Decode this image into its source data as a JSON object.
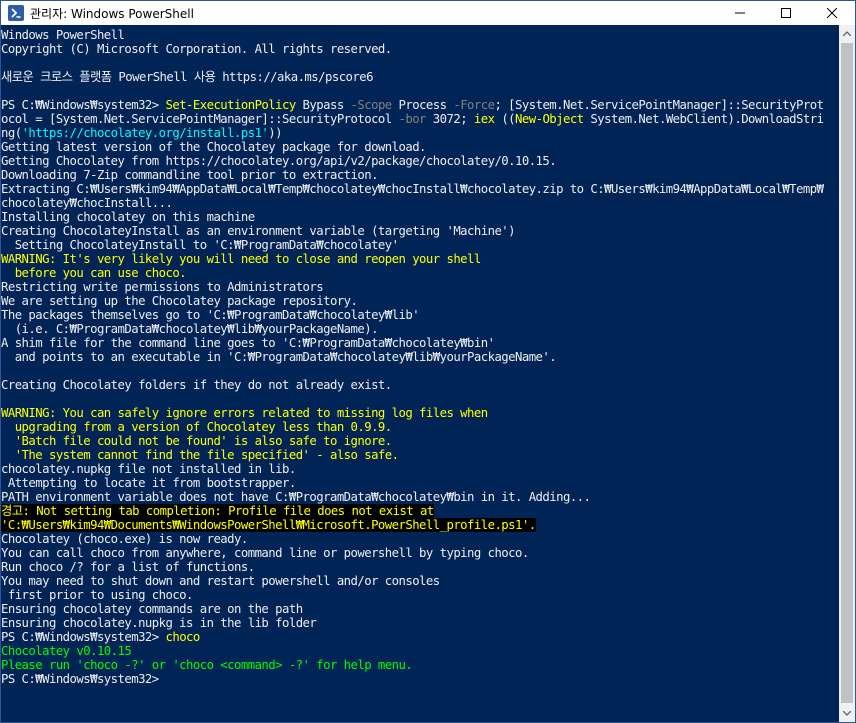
{
  "window": {
    "title": "관리자: Windows PowerShell"
  },
  "colors": {
    "background": "#012456",
    "text": "#eeedf0",
    "command": "#ffff00",
    "parameter": "#808080",
    "string": "#00ffff",
    "warning": "#ffff00",
    "error_bg": "#000000",
    "green": "#00ff00"
  },
  "console": {
    "lines": [
      [
        {
          "t": "Windows PowerShell"
        }
      ],
      [
        {
          "t": "Copyright (C) Microsoft Corporation. All rights reserved."
        }
      ],
      [],
      [
        {
          "t": "새로운 크로스 플랫폼 PowerShell 사용 https://aka.ms/pscore6"
        }
      ],
      [],
      [
        {
          "t": "PS C:₩Windows₩system32> "
        },
        {
          "t": "Set-ExecutionPolicy",
          "c": "command"
        },
        {
          "t": " Bypass "
        },
        {
          "t": "-Scope",
          "c": "parameter"
        },
        {
          "t": " Process "
        },
        {
          "t": "-Force",
          "c": "parameter"
        },
        {
          "t": "; [System.Net.ServicePointManager]::SecurityProt"
        }
      ],
      [
        {
          "t": "ocol = [System.Net.ServicePointManager]::SecurityProtocol "
        },
        {
          "t": "-bor",
          "c": "parameter"
        },
        {
          "t": " 3072; "
        },
        {
          "t": "iex",
          "c": "command"
        },
        {
          "t": " (("
        },
        {
          "t": "New-Object",
          "c": "command"
        },
        {
          "t": " System.Net.WebClient).DownloadStri"
        }
      ],
      [
        {
          "t": "ng("
        },
        {
          "t": "'https://chocolatey.org/install.ps1'",
          "c": "string"
        },
        {
          "t": "))"
        }
      ],
      [
        {
          "t": "Getting latest version of the Chocolatey package for download."
        }
      ],
      [
        {
          "t": "Getting Chocolatey from https://chocolatey.org/api/v2/package/chocolatey/0.10.15."
        }
      ],
      [
        {
          "t": "Downloading 7-Zip commandline tool prior to extraction."
        }
      ],
      [
        {
          "t": "Extracting C:₩Users₩kim94₩AppData₩Local₩Temp₩chocolatey₩chocInstall₩chocolatey.zip to C:₩Users₩kim94₩AppData₩Local₩Temp₩"
        }
      ],
      [
        {
          "t": "chocolatey₩chocInstall..."
        }
      ],
      [
        {
          "t": "Installing chocolatey on this machine"
        }
      ],
      [
        {
          "t": "Creating ChocolateyInstall as an environment variable (targeting 'Machine')"
        }
      ],
      [
        {
          "t": "  Setting ChocolateyInstall to 'C:₩ProgramData₩chocolatey'"
        }
      ],
      [
        {
          "t": "WARNING: It's very likely you will need to close and reopen your shell",
          "c": "warning"
        }
      ],
      [
        {
          "t": "  before you can use choco.",
          "c": "warning"
        }
      ],
      [
        {
          "t": "Restricting write permissions to Administrators"
        }
      ],
      [
        {
          "t": "We are setting up the Chocolatey package repository."
        }
      ],
      [
        {
          "t": "The packages themselves go to 'C:₩ProgramData₩chocolatey₩lib'"
        }
      ],
      [
        {
          "t": "  (i.e. C:₩ProgramData₩chocolatey₩lib₩yourPackageName)."
        }
      ],
      [
        {
          "t": "A shim file for the command line goes to 'C:₩ProgramData₩chocolatey₩bin'"
        }
      ],
      [
        {
          "t": "  and points to an executable in 'C:₩ProgramData₩chocolatey₩lib₩yourPackageName'."
        }
      ],
      [],
      [
        {
          "t": "Creating Chocolatey folders if they do not already exist."
        }
      ],
      [],
      [
        {
          "t": "WARNING: You can safely ignore errors related to missing log files when",
          "c": "warning"
        }
      ],
      [
        {
          "t": "  upgrading from a version of Chocolatey less than 0.9.9.",
          "c": "warning"
        }
      ],
      [
        {
          "t": "  'Batch file could not be found' is also safe to ignore.",
          "c": "warning"
        }
      ],
      [
        {
          "t": "  'The system cannot find the file specified' - also safe.",
          "c": "warning"
        }
      ],
      [
        {
          "t": "chocolatey.nupkg file not installed in lib."
        }
      ],
      [
        {
          "t": " Attempting to locate it from bootstrapper."
        }
      ],
      [
        {
          "t": "PATH environment variable does not have C:₩ProgramData₩chocolatey₩bin in it. Adding..."
        }
      ],
      [
        {
          "t": "경고: Not setting tab completion: Profile file does not exist at",
          "c": "error"
        }
      ],
      [
        {
          "t": "'C:₩Users₩kim94₩Documents₩WindowsPowerShell₩Microsoft.PowerShell_profile.ps1'.",
          "c": "error"
        }
      ],
      [
        {
          "t": "Chocolatey (choco.exe) is now ready."
        }
      ],
      [
        {
          "t": "You can call choco from anywhere, command line or powershell by typing choco."
        }
      ],
      [
        {
          "t": "Run choco /? for a list of functions."
        }
      ],
      [
        {
          "t": "You may need to shut down and restart powershell and/or consoles"
        }
      ],
      [
        {
          "t": " first prior to using choco."
        }
      ],
      [
        {
          "t": "Ensuring chocolatey commands are on the path"
        }
      ],
      [
        {
          "t": "Ensuring chocolatey.nupkg is in the lib folder"
        }
      ],
      [
        {
          "t": "PS C:₩Windows₩system32> "
        },
        {
          "t": "choco",
          "c": "command"
        }
      ],
      [
        {
          "t": "Chocolatey v0.10.15",
          "c": "green"
        }
      ],
      [
        {
          "t": "Please run 'choco -?' or 'choco <command> -?' for help menu.",
          "c": "green"
        }
      ],
      [
        {
          "t": "PS C:₩Windows₩system32>"
        }
      ]
    ]
  }
}
